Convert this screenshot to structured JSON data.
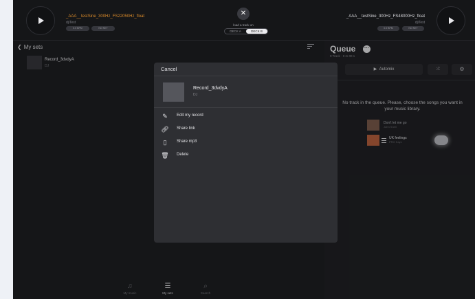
{
  "deck_left": {
    "title": "_AAA__testSine_300Hz_FS22050Hz_float",
    "artist": "djiTest",
    "bpm_pill": "0.0 BPM",
    "key_pill": "NO KEY"
  },
  "deck_center": {
    "load_label": "load a track on",
    "deck_a": "DECK A",
    "deck_b": "DECK B"
  },
  "deck_right": {
    "title": "_AAA__testSine_300Hz_FS48000Hz_float",
    "artist": "djiTest",
    "bpm_pill": "0.0 BPM",
    "key_pill": "NO KEY"
  },
  "sets": {
    "back_label": "My sets",
    "items": [
      {
        "name": "Record_3dvdyA",
        "subtitle": "DJ"
      }
    ]
  },
  "tabs": [
    {
      "label": "My music",
      "icon": "music-file-icon"
    },
    {
      "label": "My sets",
      "icon": "stack-icon"
    },
    {
      "label": "Search",
      "icon": "search-icon"
    }
  ],
  "queue": {
    "title": "Queue",
    "count": "0 Track · 0 m 00 s",
    "automix_label": "Automix",
    "empty_line1": "No track in the queue. Please, choose the songs you want in",
    "empty_line2": "your music library.",
    "songs": [
      {
        "name": "Don't let me go",
        "artist": "John Snell"
      },
      {
        "name": "UK feelings",
        "artist": "PRO Kayz"
      }
    ]
  },
  "modal": {
    "cancel_label": "Cancel",
    "record_name": "Record_3dvdyA",
    "record_subtitle": "DJ",
    "actions": [
      {
        "label": "Edit my record",
        "icon": "edit-icon"
      },
      {
        "label": "Share link",
        "icon": "link-icon"
      },
      {
        "label": "Share mp3",
        "icon": "file-icon"
      },
      {
        "label": "Delete",
        "icon": "trash-icon"
      }
    ]
  },
  "colors": {
    "accent_orange": "#d98a2a",
    "background": "#1b1c1f",
    "modal": "#2e2f33"
  }
}
